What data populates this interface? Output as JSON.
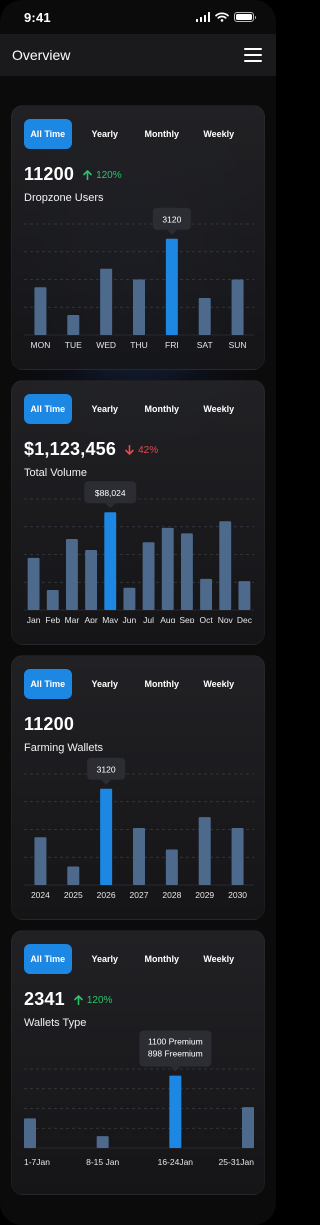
{
  "status": {
    "time": "9:41"
  },
  "header": {
    "title": "Overview"
  },
  "tabs": [
    "All Time",
    "Yearly",
    "Monthly",
    "Weekly"
  ],
  "cards": [
    {
      "value": "11200",
      "delta": {
        "text": "120%",
        "direction": "up"
      },
      "label": "Dropzone Users",
      "chart_data": {
        "type": "bar",
        "categories": [
          "MON",
          "TUE",
          "WED",
          "THU",
          "FRI",
          "SAT",
          "SUN"
        ],
        "values": [
          1550,
          650,
          2150,
          1800,
          3120,
          1200,
          1800
        ],
        "highlight_index": 4,
        "tooltip": [
          "3120"
        ],
        "ylim": [
          0,
          3600
        ],
        "grid": true
      }
    },
    {
      "value": "$1,123,456",
      "delta": {
        "text": "42%",
        "direction": "down"
      },
      "label": "Total Volume",
      "chart_data": {
        "type": "bar",
        "categories": [
          "Jan",
          "Feb",
          "Mar",
          "Apr",
          "May",
          "Jun",
          "Jul",
          "Aug",
          "Sep",
          "Oct",
          "Nov",
          "Dec"
        ],
        "values": [
          47000,
          18000,
          64000,
          54000,
          88024,
          20000,
          61000,
          74000,
          69000,
          28000,
          80000,
          26000
        ],
        "highlight_index": 4,
        "tooltip": [
          "$88,024"
        ],
        "ylim": [
          0,
          100000
        ],
        "grid": true
      }
    },
    {
      "value": "11200",
      "delta": null,
      "label": "Farming Wallets",
      "chart_data": {
        "type": "bar",
        "categories": [
          "2024",
          "2025",
          "2026",
          "2027",
          "2028",
          "2029",
          "2030"
        ],
        "values": [
          1550,
          600,
          3120,
          1850,
          1150,
          2200,
          1850
        ],
        "highlight_index": 2,
        "tooltip": [
          "3120"
        ],
        "ylim": [
          0,
          3600
        ],
        "grid": true
      }
    },
    {
      "value": "2341",
      "delta": {
        "text": "120%",
        "direction": "up"
      },
      "label": "Wallets Type",
      "chart_data": {
        "type": "bar",
        "categories": [
          "1-7Jan",
          "8-15 Jan",
          "16-24Jan",
          "25-31Jan"
        ],
        "values": [
          450,
          180,
          1100,
          620
        ],
        "highlight_index": 2,
        "tooltip": [
          "1100 Premium",
          "898 Freemium"
        ],
        "ylim": [
          0,
          1200
        ],
        "grid": true
      }
    }
  ],
  "colors": {
    "accent": "#1d87e4",
    "bar": "#4d6a8c",
    "up": "#2cc36b",
    "down": "#e5484d"
  }
}
